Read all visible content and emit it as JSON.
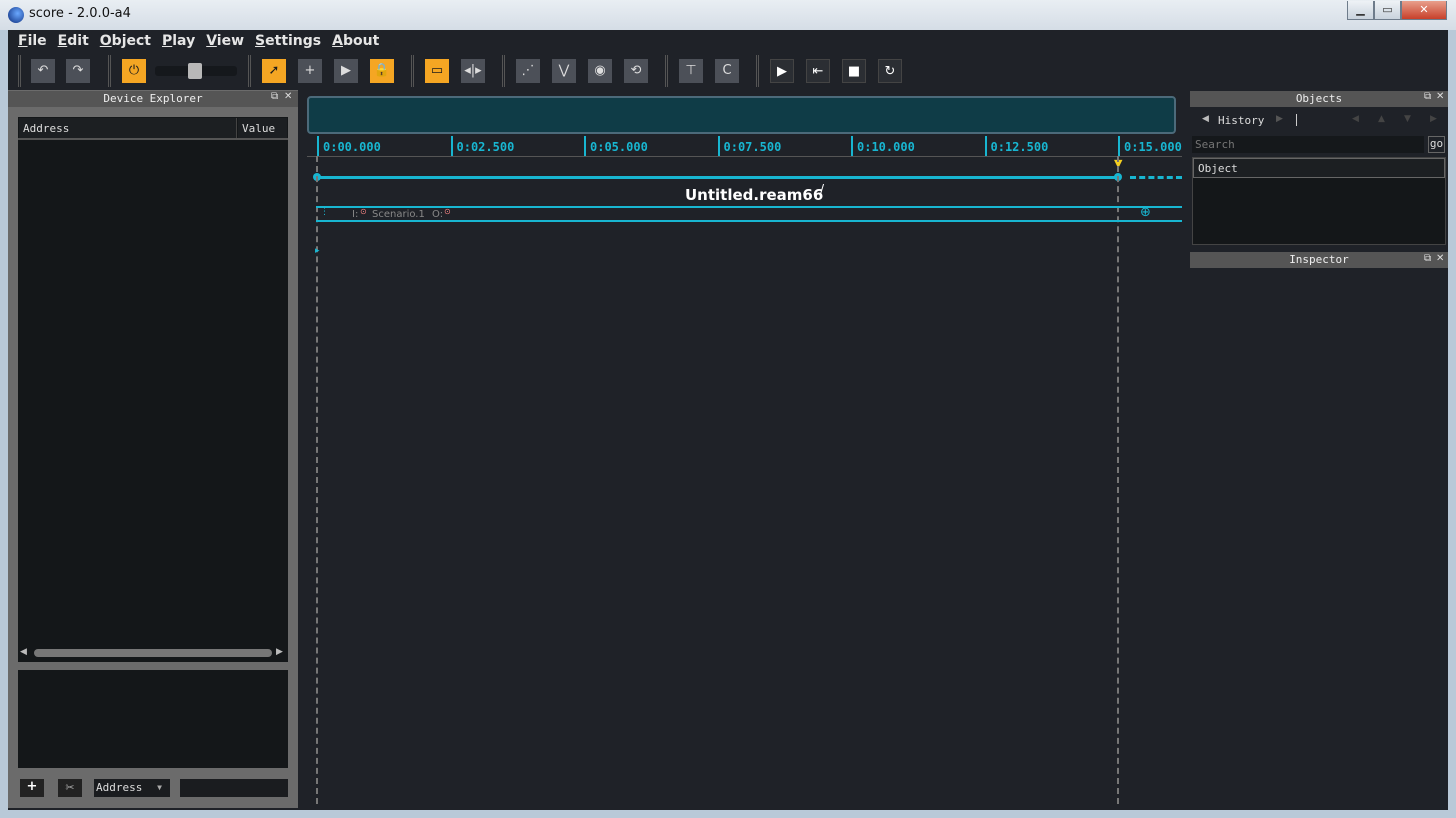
{
  "window": {
    "title": "score - 2.0.0-a4",
    "controls": [
      "minimize",
      "maximize",
      "close"
    ]
  },
  "menu": [
    "File",
    "Edit",
    "Object",
    "Play",
    "View",
    "Settings",
    "About"
  ],
  "toolbar": {
    "groups": [
      [
        {
          "icon": "undo-icon",
          "glyph": "↶"
        },
        {
          "icon": "redo-icon",
          "glyph": "↷"
        }
      ],
      [
        {
          "icon": "power-icon",
          "glyph": "⏻",
          "active": true
        }
      ],
      [
        {
          "icon": "select-cursor-icon",
          "glyph": "➚",
          "active": true
        },
        {
          "icon": "create-icon",
          "glyph": "+"
        },
        {
          "icon": "play-icon",
          "glyph": "▶"
        },
        {
          "icon": "lock-icon",
          "glyph": "🔒",
          "active": true
        }
      ],
      [
        {
          "icon": "scale-icon",
          "glyph": "▭",
          "active": true
        },
        {
          "icon": "grow-shrink-icon",
          "glyph": "◂|▸"
        }
      ],
      [
        {
          "icon": "link-points-icon",
          "glyph": "⋰"
        },
        {
          "icon": "curve-icon",
          "glyph": "⋁"
        },
        {
          "icon": "snapshot-icon",
          "glyph": "◉"
        },
        {
          "icon": "refresh-snapshot-icon",
          "glyph": "⟲"
        }
      ],
      [
        {
          "icon": "trigger-icon",
          "glyph": "⊤"
        },
        {
          "icon": "condition-icon",
          "glyph": "C"
        }
      ],
      [
        {
          "icon": "transport-play-icon",
          "glyph": "▶"
        },
        {
          "icon": "play-from-start-icon",
          "glyph": "⇤"
        },
        {
          "icon": "stop-icon",
          "glyph": "■"
        },
        {
          "icon": "reinitialize-icon",
          "glyph": "↻"
        }
      ]
    ],
    "speed_slider": 0.5
  },
  "device_explorer": {
    "title": "Device Explorer",
    "columns": [
      "Address",
      "Value"
    ],
    "filter_select": "Address",
    "filter_input": ""
  },
  "timeline": {
    "ticks": [
      "0:00.000",
      "0:02.500",
      "0:05.000",
      "0:07.500",
      "0:10.000",
      "0:12.500",
      "0:15.000"
    ],
    "scenario_title": "Untitled.ream66",
    "slot_label": "Scenario.1",
    "inlet_label": "I:",
    "outlet_label": "O:"
  },
  "objects": {
    "title": "Objects",
    "history_label": "History",
    "search_placeholder": "Search",
    "go_label": "go",
    "list_header": "Object"
  },
  "inspector": {
    "title": "Inspector"
  },
  "colors": {
    "accent": "#18b6d1",
    "active": "#f5a623",
    "background": "#1f2228"
  }
}
